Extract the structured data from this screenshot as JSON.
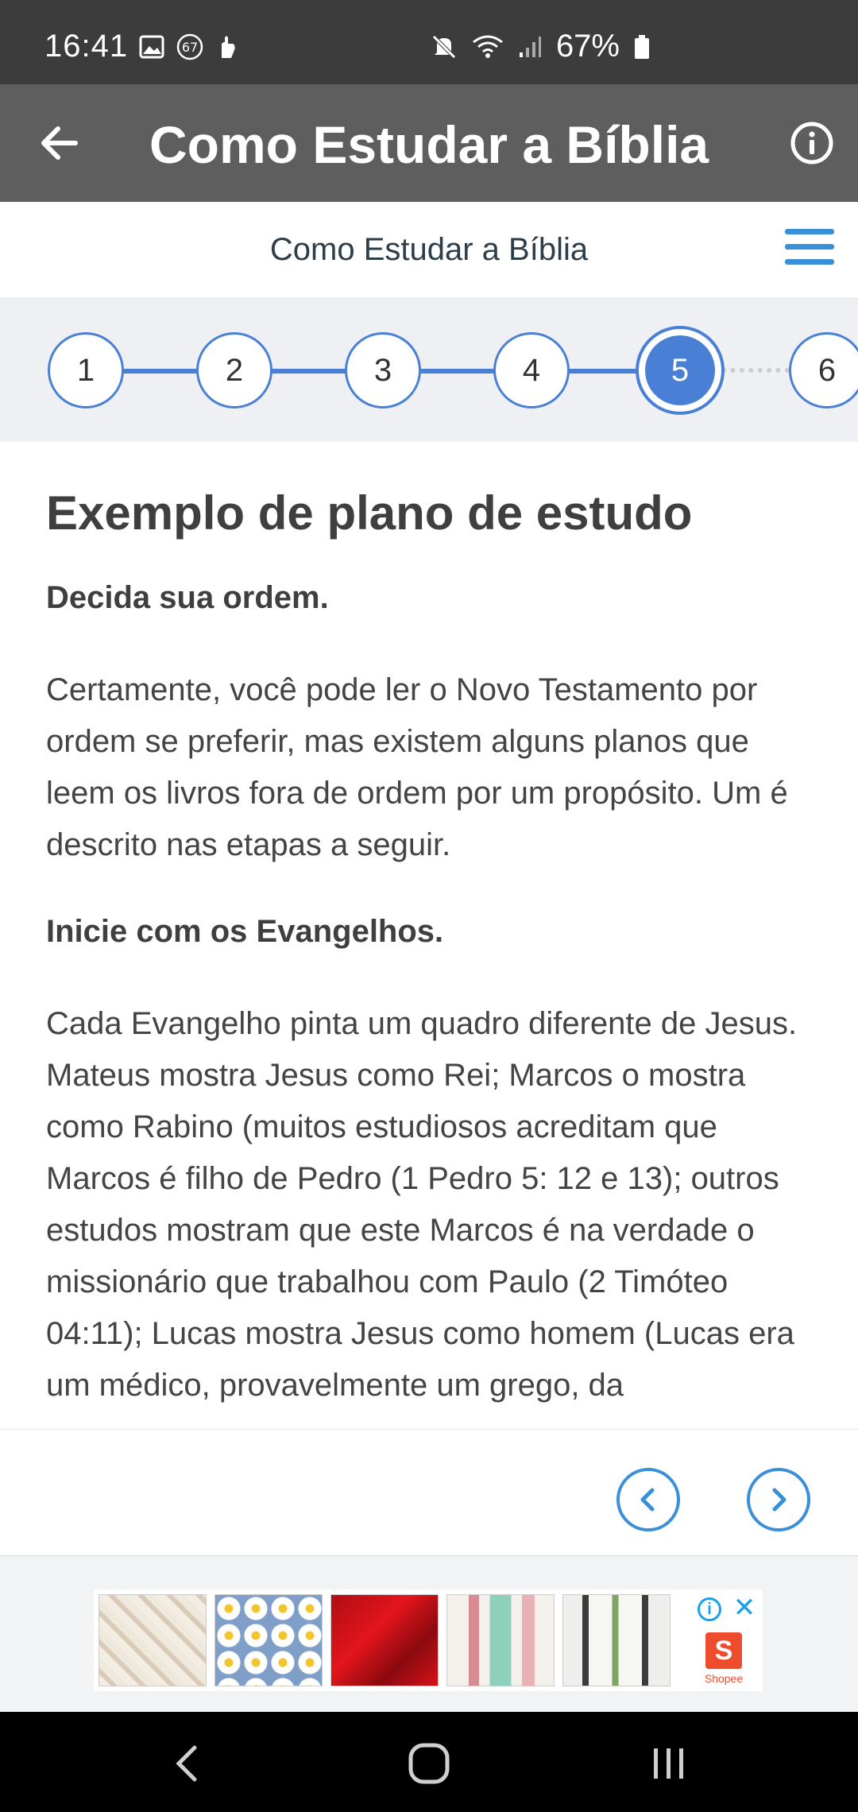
{
  "status_bar": {
    "time": "16:41",
    "notification_badge": "67",
    "battery": "67%",
    "icons": [
      "image-icon",
      "badge-icon",
      "hand-icon",
      "mute-icon",
      "wifi-icon",
      "signal-icon",
      "battery-icon"
    ]
  },
  "app_bar": {
    "title": "Como Estudar a Bíblia",
    "back_icon": "arrow-left-icon",
    "info_icon": "info-icon"
  },
  "sub_header": {
    "title": "Como Estudar a Bíblia",
    "menu_icon": "hamburger-menu-icon"
  },
  "steps": {
    "items": [
      "1",
      "2",
      "3",
      "4",
      "5",
      "6"
    ],
    "active": 5,
    "accent_color": "#4a7fd6"
  },
  "content": {
    "heading": "Exemplo de plano de estudo",
    "sub1": "Decida sua ordem.",
    "para1": "Certamente, você pode ler o Novo Testamento por ordem se preferir, mas existem alguns planos que leem os livros fora de ordem por um propósito. Um é descrito nas etapas a seguir.",
    "sub2": "Inicie com os Evangelhos.",
    "para2": "Cada Evangelho pinta um quadro diferente de Jesus. Mateus mostra Jesus como Rei; Marcos o mostra como Rabino (muitos estudiosos acreditam que Marcos é filho de Pedro (1 Pedro 5: 12 e 13); outros estudos mostram que este Marcos é na verdade o missionário que trabalhou com Paulo (2 Timóteo 04:11); Lucas mostra Jesus como homem (Lucas era um médico, provavelmente um grego, da"
  },
  "bottom_nav": {
    "prev_icon": "chevron-left-icon",
    "next_icon": "chevron-right-icon",
    "accent_color": "#3a8fd9"
  },
  "ad": {
    "brand": "Shopee",
    "brand_letter": "S",
    "info_icon": "ad-info-icon",
    "close_icon": "ad-close-icon",
    "close_glyph": "✕",
    "info_glyph": "i"
  },
  "system_nav": {
    "buttons": [
      "back-icon",
      "home-icon",
      "recents-icon"
    ]
  }
}
